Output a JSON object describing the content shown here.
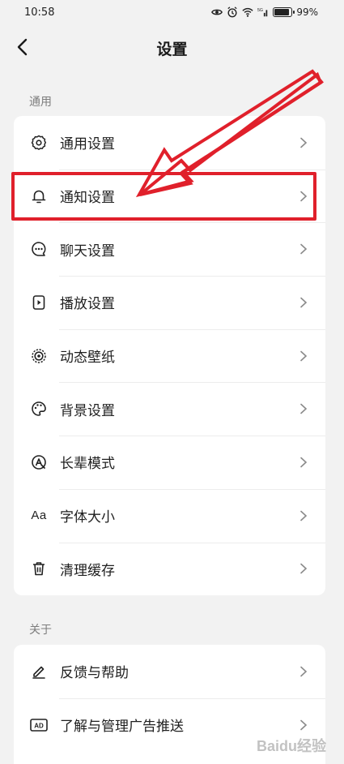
{
  "status_bar": {
    "time": "10:58",
    "battery": "99%",
    "icons": [
      "eye-icon",
      "alarm-icon",
      "wifi-icon",
      "signal-5g-icon",
      "battery-icon"
    ]
  },
  "header": {
    "title": "设置",
    "back_icon": "chevron-left-icon"
  },
  "sections": [
    {
      "label": "通用",
      "items": [
        {
          "label": "通用设置",
          "icon": "gear-icon"
        },
        {
          "label": "通知设置",
          "icon": "bell-icon"
        },
        {
          "label": "聊天设置",
          "icon": "chat-bubble-icon"
        },
        {
          "label": "播放设置",
          "icon": "play-card-icon"
        },
        {
          "label": "动态壁纸",
          "icon": "live-wallpaper-icon"
        },
        {
          "label": "背景设置",
          "icon": "palette-icon"
        },
        {
          "label": "长辈模式",
          "icon": "elder-mode-icon"
        },
        {
          "label": "字体大小",
          "icon": "font-size-icon",
          "icon_text": "Aa"
        },
        {
          "label": "清理缓存",
          "icon": "trash-icon"
        }
      ]
    },
    {
      "label": "关于",
      "items": [
        {
          "label": "反馈与帮助",
          "icon": "pencil-icon"
        },
        {
          "label": "了解与管理广告推送",
          "icon": "ad-icon",
          "icon_text": "AD"
        }
      ]
    }
  ],
  "annotation": {
    "highlight_color": "#e0202b",
    "highlighted_item": "通知设置"
  },
  "watermark": "Baidu经验"
}
